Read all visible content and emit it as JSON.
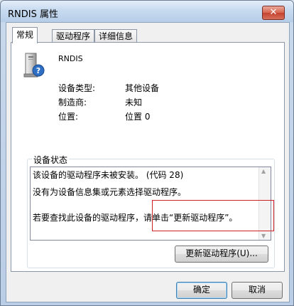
{
  "window": {
    "title": "RNDIS 属性",
    "close_glyph": "✕"
  },
  "tabs": [
    {
      "label": "常规",
      "active": true
    },
    {
      "label": "驱动程序",
      "active": false
    },
    {
      "label": "详细信息",
      "active": false
    }
  ],
  "device": {
    "name": "RNDIS",
    "icon": "unknown-device-icon",
    "properties": [
      {
        "label": "设备类型:",
        "value": "其他设备"
      },
      {
        "label": "制造商:",
        "value": "未知"
      },
      {
        "label": "位置:",
        "value": "位置 0"
      }
    ]
  },
  "status": {
    "group_title": "设备状态",
    "lines": [
      "该设备的驱动程序未被安装。 (代码 28)",
      "没有为设备信息集或元素选择驱动程序。",
      "",
      "若要查找此设备的驱动程序，请单击“更新驱动程序”。"
    ],
    "update_button": "更新驱动程序(U)..."
  },
  "footer": {
    "ok": "确定",
    "cancel": "取消"
  },
  "colors": {
    "highlight": "#d02020",
    "title_bar": "#c7daf0"
  }
}
